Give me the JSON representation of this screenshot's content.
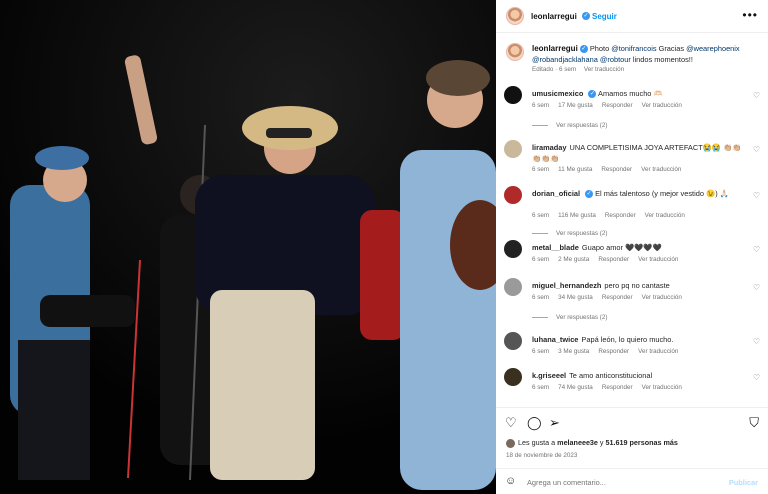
{
  "photo": {
    "alt_icon": "concert-photo"
  },
  "header": {
    "username": "leonlarregui",
    "verified_icon": "verified-badge-icon",
    "separator": "•",
    "follow_label": "Seguir",
    "more_icon": "more-options-icon",
    "more_glyph": "•••"
  },
  "caption": {
    "username": "leonlarregui",
    "text_before": "Photo ",
    "mention1": "@tonifrancois",
    "text_mid": " Gracias ",
    "mention2": "@wearephoenix",
    "mention3": "@robandjacklahana",
    "mention4": "@robtour",
    "text_after": " lindos momentos!!",
    "edited": "Editado · 6 sem",
    "translate": "Ver traducción"
  },
  "comments": [
    {
      "username": "umusicmexico",
      "verified": true,
      "text": "Amamos mucho 🫶🏻",
      "age": "6 sem",
      "likes": "17 Me gusta",
      "reply": "Responder",
      "translate": "Ver traducción",
      "replies": "Ver respuestas (2)",
      "avatar_color": "#111111"
    },
    {
      "username": "liramaday",
      "verified": false,
      "text": "UNA COMPLETISIMA JOYA ARTEFACT😭😭 👏🏼👏🏼👏🏼👏🏼👏🏼",
      "age": "6 sem",
      "likes": "11 Me gusta",
      "reply": "Responder",
      "translate": "Ver traducción",
      "replies": "",
      "avatar_color": "#c9b89a"
    },
    {
      "username": "dorian_oficial",
      "verified": true,
      "text": "El más talentoso (y mejor vestido 😉) 🙏🏻",
      "age": "6 sem",
      "likes": "116 Me gusta",
      "reply": "Responder",
      "translate": "Ver traducción",
      "replies": "Ver respuestas (2)",
      "avatar_color": "#b02a2a"
    },
    {
      "username": "metal__blade",
      "verified": false,
      "text": "Guapo amor 🖤🖤🖤🖤",
      "age": "6 sem",
      "likes": "2 Me gusta",
      "reply": "Responder",
      "translate": "Ver traducción",
      "replies": "",
      "avatar_color": "#222222"
    },
    {
      "username": "miguel_hernandezh",
      "verified": false,
      "text": "pero pq no cantaste",
      "age": "6 sem",
      "likes": "34 Me gusta",
      "reply": "Responder",
      "translate": "Ver traducción",
      "replies": "Ver respuestas (2)",
      "avatar_color": "#9a9a9a"
    },
    {
      "username": "luhana_twice",
      "verified": false,
      "text": "Papá león, lo quiero mucho.",
      "age": "6 sem",
      "likes": "3 Me gusta",
      "reply": "Responder",
      "translate": "Ver traducción",
      "replies": "",
      "avatar_color": "#555555"
    },
    {
      "username": "k.griseeel",
      "verified": false,
      "text": "Te amo anticonstitucional",
      "age": "6 sem",
      "likes": "74 Me gusta",
      "reply": "Responder",
      "translate": "Ver traducción",
      "replies": "",
      "avatar_color": "#3a3020"
    }
  ],
  "actions": {
    "like_icon": "heart-icon",
    "like_glyph": "♡",
    "comment_icon": "comment-icon",
    "comment_glyph": "◯",
    "share_icon": "share-icon",
    "share_glyph": "➢",
    "save_icon": "bookmark-icon",
    "save_glyph": "⛉"
  },
  "likes": {
    "prefix": "Les gusta a ",
    "user": "melaneee3e",
    "mid": " y ",
    "count": "51.619 personas más"
  },
  "date": "18 de noviembre de 2023",
  "add_comment": {
    "emoji_glyph": "☺",
    "placeholder": "Agrega un comentario...",
    "publish": "Publicar"
  },
  "colors": {
    "accent": "#0095f6",
    "muted": "#737373",
    "link": "#00376b"
  }
}
